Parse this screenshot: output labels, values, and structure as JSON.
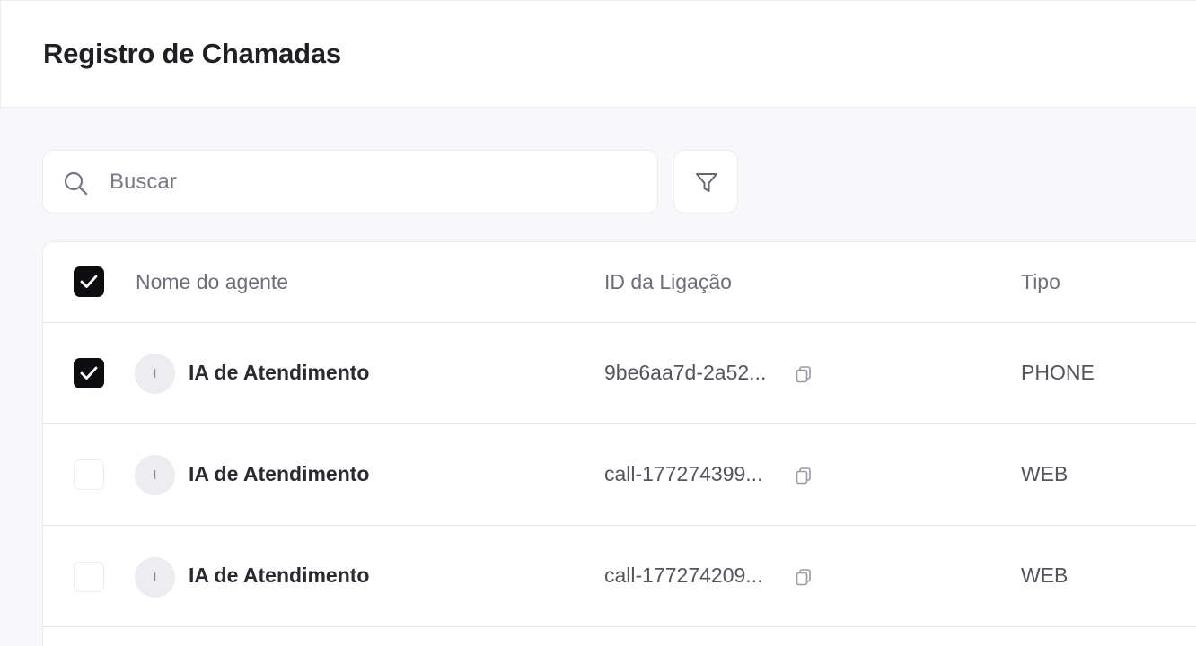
{
  "header": {
    "title": "Registro de Chamadas"
  },
  "search": {
    "placeholder": "Buscar",
    "value": ""
  },
  "table": {
    "columns": {
      "agent": "Nome do agente",
      "call_id": "ID da Ligação",
      "type": "Tipo"
    },
    "select_all_checked": true,
    "rows": [
      {
        "selected": true,
        "avatar_initial": "I",
        "agent_name": "IA de Atendimento",
        "call_id": "9be6aa7d-2a52...",
        "type": "PHONE"
      },
      {
        "selected": false,
        "avatar_initial": "I",
        "agent_name": "IA de Atendimento",
        "call_id": "call-177274399...",
        "type": "WEB"
      },
      {
        "selected": false,
        "avatar_initial": "I",
        "agent_name": "IA de Atendimento",
        "call_id": "call-177274209...",
        "type": "WEB"
      }
    ]
  },
  "icons": {
    "search": "search-icon",
    "filter": "filter-icon",
    "check": "check-icon",
    "copy": "copy-icon"
  },
  "colors": {
    "checkbox_checked": "#0d0d10",
    "page_background": "#f8f8fa",
    "border": "#ececf1"
  }
}
